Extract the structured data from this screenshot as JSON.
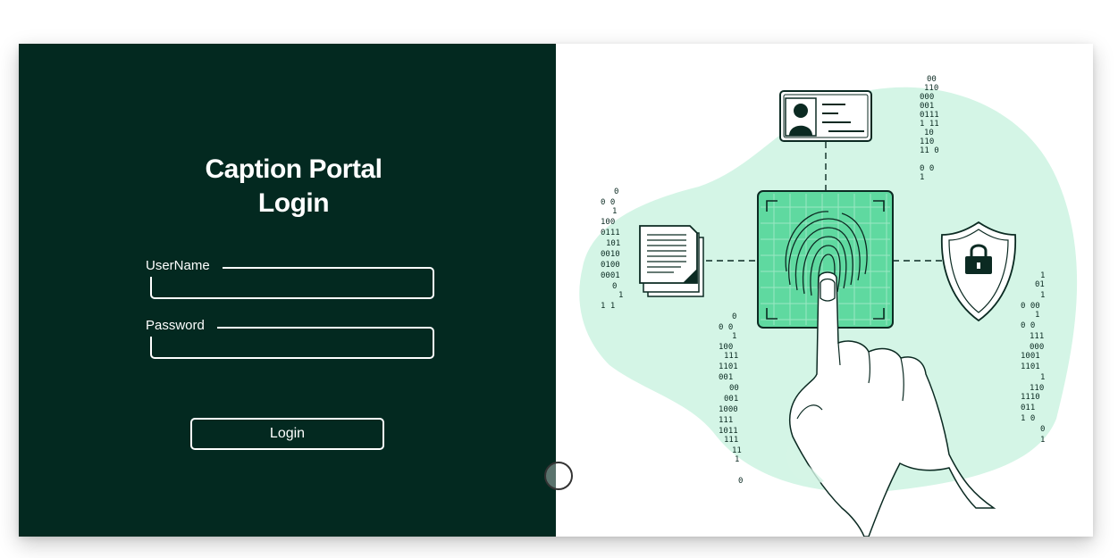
{
  "login": {
    "title_line1": "Caption Portal",
    "title_line2": "Login",
    "username": {
      "label": "UserName",
      "value": ""
    },
    "password": {
      "label": "Password",
      "value": ""
    },
    "button_label": "Login"
  },
  "illustration": {
    "icons": [
      "id-card-icon",
      "document-icon",
      "fingerprint-icon",
      "shield-lock-icon",
      "hand-icon"
    ],
    "accent_color": "#d4f5e6",
    "scanner_color": "#5fd9a0",
    "binary_columns": [
      [
        "00",
        "110",
        "000",
        "001",
        "0111",
        "1 11",
        "10",
        "110",
        "11 0",
        "",
        "0  0",
        "1"
      ],
      [
        "0",
        "0 0",
        "1",
        "100",
        "0111",
        "101",
        "0010",
        "0100",
        "0001",
        "0",
        "1",
        "1 1"
      ],
      [
        "0",
        "0 0",
        "1",
        "100",
        "111",
        "1101",
        "001",
        "00",
        "001",
        "1000",
        "111",
        "1011",
        "111",
        "11",
        "1",
        "",
        "0"
      ],
      [
        "1",
        "01",
        "1",
        "0 00",
        "1",
        "0 0",
        "111",
        "000",
        "1001",
        "1101",
        "1",
        "110",
        "1110",
        "011",
        "1 0",
        "0",
        "1"
      ]
    ]
  }
}
